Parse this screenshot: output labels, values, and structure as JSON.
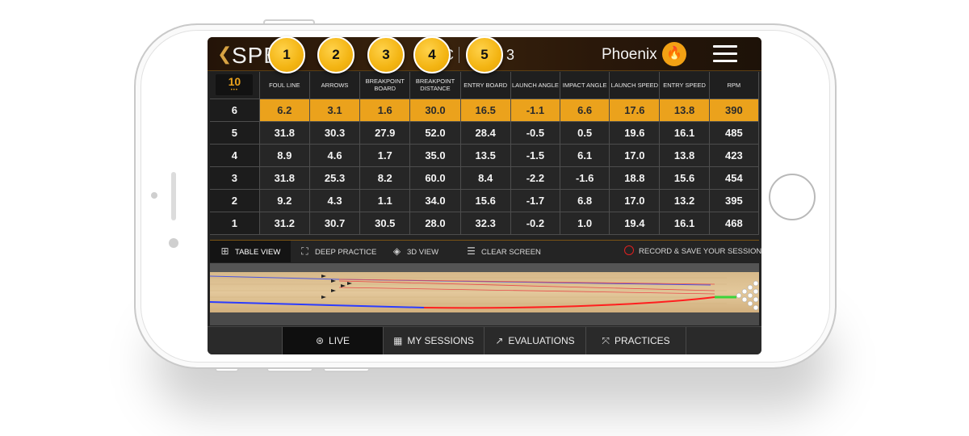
{
  "app": {
    "logo_text": "SPE",
    "game_label": "E 3",
    "game_letter": "C",
    "user_name": "Phoenix"
  },
  "table": {
    "game_number": "10",
    "game_dots": "•••",
    "headers": [
      "FOUL LINE",
      "ARROWS",
      "BREAKPOINT BOARD",
      "BREAKPOINT DISTANCE",
      "ENTRY BOARD",
      "LAUNCH ANGLE",
      "IMPACT ANGLE",
      "LAUNCH SPEED",
      "ENTRY SPEED",
      "RPM"
    ],
    "rows": [
      {
        "frame": "6",
        "values": [
          "6.2",
          "3.1",
          "1.6",
          "30.0",
          "16.5",
          "-1.1",
          "6.6",
          "17.6",
          "13.8",
          "390"
        ]
      },
      {
        "frame": "5",
        "values": [
          "31.8",
          "30.3",
          "27.9",
          "52.0",
          "28.4",
          "-0.5",
          "0.5",
          "19.6",
          "16.1",
          "485"
        ]
      },
      {
        "frame": "4",
        "values": [
          "8.9",
          "4.6",
          "1.7",
          "35.0",
          "13.5",
          "-1.5",
          "6.1",
          "17.0",
          "13.8",
          "423"
        ]
      },
      {
        "frame": "3",
        "values": [
          "31.8",
          "25.3",
          "8.2",
          "60.0",
          "8.4",
          "-2.2",
          "-1.6",
          "18.8",
          "15.6",
          "454"
        ]
      },
      {
        "frame": "2",
        "values": [
          "9.2",
          "4.3",
          "1.1",
          "34.0",
          "15.6",
          "-1.7",
          "6.8",
          "17.0",
          "13.2",
          "395"
        ]
      },
      {
        "frame": "1",
        "values": [
          "31.2",
          "30.7",
          "30.5",
          "28.0",
          "32.3",
          "-0.2",
          "1.0",
          "19.4",
          "16.1",
          "468"
        ]
      }
    ]
  },
  "toolbar": {
    "table_view": "TABLE VIEW",
    "deep_practice": "DEEP PRACTICE",
    "view_3d": "3D VIEW",
    "clear_screen": "CLEAR SCREEN",
    "record": "RECORD & SAVE YOUR SESSION"
  },
  "nav": {
    "live": "LIVE",
    "my_sessions": "MY SESSIONS",
    "evaluations": "EVALUATIONS",
    "practices": "PRACTICES"
  },
  "callouts": [
    "1",
    "2",
    "3",
    "4",
    "5"
  ],
  "colors": {
    "accent": "#eba21c",
    "highlight_row": "#eba21c",
    "record": "#e02020",
    "ball_path_blue": "#2c3cff",
    "ball_path_red": "#ff1f1f",
    "pin_hit": "#3ad43a"
  }
}
